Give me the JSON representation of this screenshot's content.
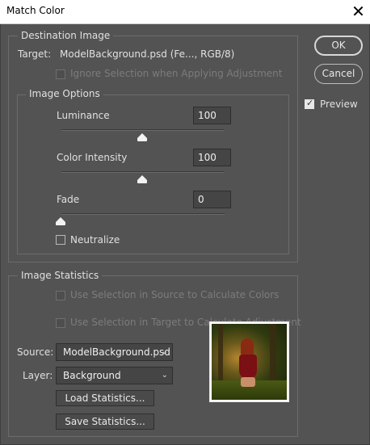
{
  "window": {
    "title": "Match Color",
    "close_glyph": "✕"
  },
  "destination": {
    "legend": "Destination Image",
    "target_label": "Target:",
    "target_value": "ModelBackground.psd (Fe..., RGB/8)",
    "ignore_selection_label": "Ignore Selection when Applying Adjustment",
    "ignore_selection_checked": false
  },
  "image_options": {
    "legend": "Image Options",
    "luminance": {
      "label": "Luminance",
      "value": "100",
      "slider_fraction": 0.5
    },
    "color_intensity": {
      "label": "Color Intensity",
      "value": "100",
      "slider_fraction": 0.5
    },
    "fade": {
      "label": "Fade",
      "value": "0",
      "slider_fraction": 0.0
    },
    "neutralize": {
      "label": "Neutralize",
      "checked": false
    }
  },
  "statistics": {
    "legend": "Image Statistics",
    "use_source_selection_label": "Use Selection in Source to Calculate Colors",
    "use_target_selection_label": "Use Selection in Target to Calculate Adjustment",
    "source_label": "Source:",
    "source_value": "ModelBackground.psd",
    "layer_label": "Layer:",
    "layer_value": "Background",
    "load_button": "Load Statistics...",
    "save_button": "Save Statistics..."
  },
  "buttons": {
    "ok": "OK",
    "cancel": "Cancel"
  },
  "preview": {
    "label": "Preview",
    "checked": true
  },
  "icons": {
    "close": "close-icon",
    "dropdown": "chevron-down-icon"
  }
}
